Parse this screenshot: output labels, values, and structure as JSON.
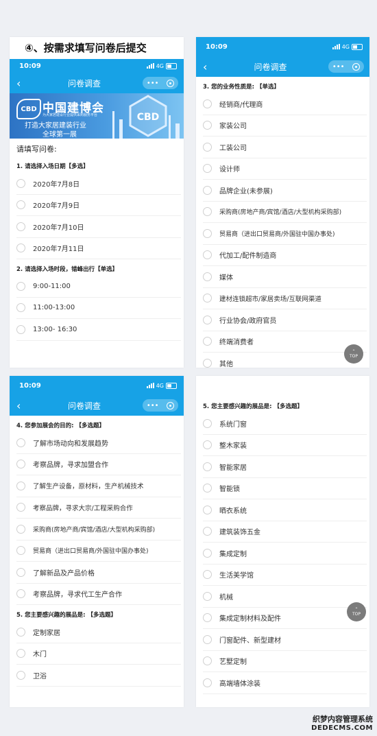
{
  "step_title": "④、按需求填写问卷后提交",
  "status_bar": {
    "time": "10:09",
    "network": "4G"
  },
  "navbar": {
    "title": "问卷调查",
    "back": "‹",
    "more": "•••"
  },
  "banner": {
    "logo": "CBD",
    "name": "中国建博会",
    "tagline": "为大家居建设行业提供采购服务平台",
    "slogan_line1": "打造大家居建装行业",
    "slogan_line2": "全球第一展"
  },
  "fill_prompt": "请填写问卷:",
  "questions": {
    "q1": {
      "title": "1. 请选择入场日期【多选】",
      "options": [
        "2020年7月8日",
        "2020年7月9日",
        "2020年7月10日",
        "2020年7月11日"
      ]
    },
    "q2": {
      "title": "2. 请选择入场时段，错峰出行【单选】",
      "options": [
        "9:00-11:00",
        "11:00-13:00",
        "13:00- 16:30"
      ]
    },
    "q3": {
      "title": "3. 您的业务性质是: 【单选】",
      "options": [
        "经销商/代理商",
        "家装公司",
        "工装公司",
        "设计师",
        "品牌企业(未参展)",
        "采购商(房地产商/宾馆/酒店/大型机构采购部)",
        "贸易商（进出口贸易商/外国驻中国办事处)",
        "代加工/配件制造商",
        "媒体",
        "建材连锁超市/家居卖场/互联网渠道",
        "行业协会/政府官员",
        "终端消费者",
        "其他"
      ]
    },
    "q4": {
      "title": "4. 您参加展会的目的: 【多选题】",
      "options": [
        "了解市场动向和发展趋势",
        "考察品牌，寻求加盟合作",
        "了解生产设备，原材料，生产机械技术",
        "考察品牌，寻求大宗/工程采购合作",
        "采购商(房地产商/宾馆/酒店/大型机构采购部)",
        "贸易商（进出口贸易商/外国驻中国办事处)",
        "了解新品及产品价格",
        "考察品牌，寻求代工生产合作"
      ]
    },
    "q5a": {
      "title": "5. 您主要感兴趣的展品是: 【多选题】",
      "options": [
        "定制家居",
        "木门",
        "卫浴"
      ]
    },
    "q5b": {
      "title": "5. 您主要感兴趣的展品是: 【多选题】",
      "options": [
        "系统门窗",
        "整木家装",
        "智能家居",
        "智能锁",
        "晒衣系统",
        "建筑装饰五金",
        "集成定制",
        "生活美学馆",
        "机械",
        "集成定制材料及配件",
        "门窗配件、新型建材",
        "艺墅定制",
        "高端墙体涂装"
      ]
    }
  },
  "top_button": {
    "arrow": "⌃",
    "label": "TOP"
  },
  "watermark": {
    "line1": "织梦内容管理系统",
    "line2": "DEDECMS.COM"
  },
  "colors": {
    "nav_blue": "#17a2e6",
    "page_bg": "#eef0f4",
    "radio_border": "#cfcfcf"
  }
}
